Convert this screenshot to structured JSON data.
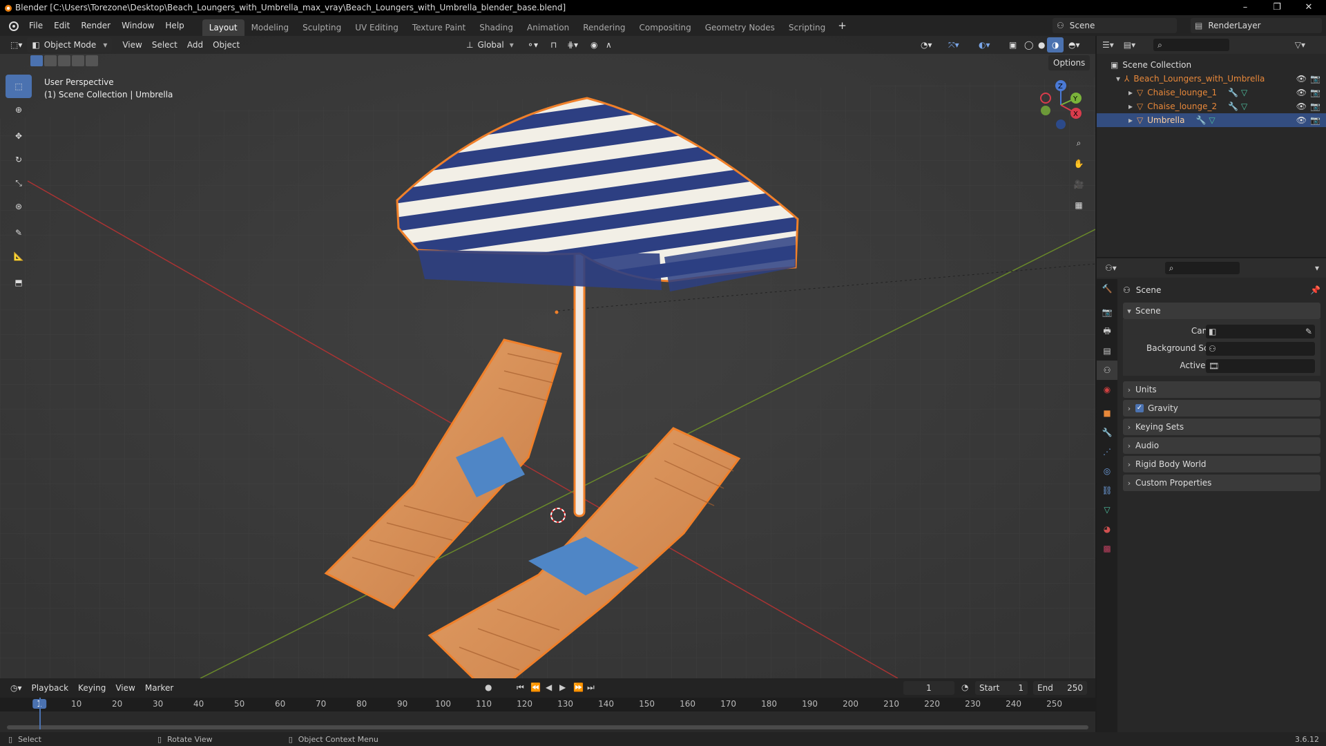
{
  "window": {
    "title": "Blender [C:\\Users\\Torezone\\Desktop\\Beach_Loungers_with_Umbrella_max_vray\\Beach_Loungers_with_Umbrella_blender_base.blend]",
    "minimize": "–",
    "maximize": "❐",
    "close": "✕"
  },
  "menu": [
    "File",
    "Edit",
    "Render",
    "Window",
    "Help"
  ],
  "workspaces": [
    "Layout",
    "Modeling",
    "Sculpting",
    "UV Editing",
    "Texture Paint",
    "Shading",
    "Animation",
    "Rendering",
    "Compositing",
    "Geometry Nodes",
    "Scripting"
  ],
  "active_workspace": "Layout",
  "add_workspace": "+",
  "scene_selector": {
    "value": "Scene"
  },
  "viewlayer_selector": {
    "value": "RenderLayer"
  },
  "viewport_header": {
    "mode": "Object Mode",
    "menus": [
      "View",
      "Select",
      "Add",
      "Object"
    ],
    "orientation": "Global",
    "options": "Options"
  },
  "viewport": {
    "overlay_line1": "User Perspective",
    "overlay_line2": "(1) Scene Collection | Umbrella",
    "gizmo_axes": {
      "x": "X",
      "y": "Y",
      "z": "Z"
    }
  },
  "outliner": {
    "root": "Scene Collection",
    "items": [
      {
        "name": "Beach_Loungers_with_Umbrella",
        "level": 1,
        "selected": false
      },
      {
        "name": "Chaise_lounge_1",
        "level": 2,
        "selected": false
      },
      {
        "name": "Chaise_lounge_2",
        "level": 2,
        "selected": false
      },
      {
        "name": "Umbrella",
        "level": 2,
        "selected": true
      }
    ]
  },
  "properties": {
    "header": "Scene",
    "section": "Scene",
    "fields": [
      {
        "label": "Camera",
        "value": ""
      },
      {
        "label": "Background Scene",
        "value": ""
      },
      {
        "label": "Active Clip",
        "value": ""
      }
    ],
    "panels": [
      "Units",
      "Gravity",
      "Keying Sets",
      "Audio",
      "Rigid Body World",
      "Custom Properties"
    ],
    "gravity_checked": true
  },
  "timeline": {
    "menus": [
      "Playback",
      "Keying",
      "View",
      "Marker"
    ],
    "current_frame": "1",
    "start_label": "Start",
    "start": "1",
    "end_label": "End",
    "end": "250",
    "ruler": [
      "1",
      "10",
      "20",
      "30",
      "40",
      "50",
      "60",
      "70",
      "80",
      "90",
      "100",
      "110",
      "120",
      "130",
      "140",
      "150",
      "160",
      "170",
      "180",
      "190",
      "200",
      "210",
      "220",
      "230",
      "240",
      "250"
    ]
  },
  "statusbar": {
    "select": "Select",
    "rotate": "Rotate View",
    "context": "Object Context Menu",
    "version": "3.6.12"
  },
  "colors": {
    "accent": "#4b72b0",
    "selection_outline": "#f0802a",
    "outliner_selected": "#334d80",
    "collection_orange": "#e8883a"
  }
}
